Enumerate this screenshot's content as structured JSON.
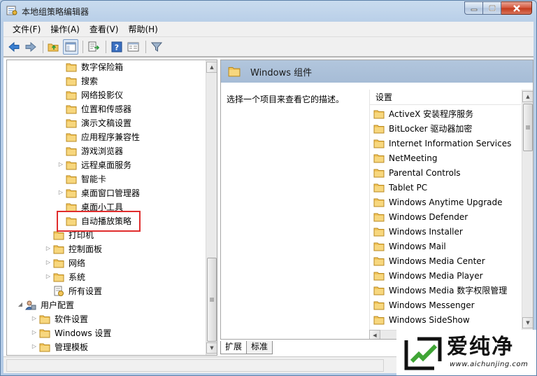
{
  "window": {
    "title": "本地组策略编辑器"
  },
  "menu": [
    "文件(F)",
    "操作(A)",
    "查看(V)",
    "帮助(H)"
  ],
  "toolbar": {
    "buttons": [
      "back-icon",
      "forward-icon",
      "up-folder-icon",
      "show-hide-tree-icon",
      "export-list-icon",
      "help-icon",
      "properties-icon",
      "filter-icon"
    ]
  },
  "tree": {
    "items": [
      {
        "label": "数字保险箱",
        "level": 3,
        "expandable": false
      },
      {
        "label": "搜索",
        "level": 3,
        "expandable": false
      },
      {
        "label": "网络投影仪",
        "level": 3,
        "expandable": false
      },
      {
        "label": "位置和传感器",
        "level": 3,
        "expandable": false
      },
      {
        "label": "演示文稿设置",
        "level": 3,
        "expandable": false
      },
      {
        "label": "应用程序兼容性",
        "level": 3,
        "expandable": false
      },
      {
        "label": "游戏浏览器",
        "level": 3,
        "expandable": false
      },
      {
        "label": "远程桌面服务",
        "level": 3,
        "expandable": true
      },
      {
        "label": "智能卡",
        "level": 3,
        "expandable": false
      },
      {
        "label": "桌面窗口管理器",
        "level": 3,
        "expandable": true
      },
      {
        "label": "桌面小工具",
        "level": 3,
        "expandable": false
      },
      {
        "label": "自动播放策略",
        "level": 3,
        "expandable": false
      },
      {
        "label": "打印机",
        "level": 2,
        "expandable": false
      },
      {
        "label": "控制面板",
        "level": 2,
        "expandable": true
      },
      {
        "label": "网络",
        "level": 2,
        "expandable": true
      },
      {
        "label": "系统",
        "level": 2,
        "expandable": true
      },
      {
        "label": "所有设置",
        "level": 2,
        "expandable": false,
        "icon": "all-settings-icon"
      },
      {
        "label": "用户配置",
        "level": 0,
        "expandable": true,
        "expanded": true,
        "icon": "user-config-icon"
      },
      {
        "label": "软件设置",
        "level": 1,
        "expandable": true
      },
      {
        "label": "Windows 设置",
        "level": 1,
        "expandable": true
      },
      {
        "label": "管理模板",
        "level": 1,
        "expandable": true
      }
    ],
    "highlighted": "自动播放策略"
  },
  "right": {
    "header": "Windows 组件",
    "description": "选择一个项目来查看它的描述。",
    "settings_header": "设置",
    "settings": [
      "ActiveX 安装程序服务",
      "BitLocker 驱动器加密",
      "Internet Information Services",
      "NetMeeting",
      "Parental Controls",
      "Tablet PC",
      "Windows Anytime Upgrade",
      "Windows Defender",
      "Windows Installer",
      "Windows Mail",
      "Windows Media Center",
      "Windows Media Player",
      "Windows Media 数字权限管理",
      "Windows Messenger",
      "Windows SideShow"
    ]
  },
  "tabs": [
    {
      "label": "扩展",
      "active": true
    },
    {
      "label": "标准",
      "active": false
    }
  ],
  "watermark": {
    "text": "爱纯净",
    "url": "www.aichunjing.com"
  },
  "colors": {
    "highlight_border": "#e02d2d",
    "folder": "#f2c45a",
    "header_blue": "#aac0d9"
  }
}
